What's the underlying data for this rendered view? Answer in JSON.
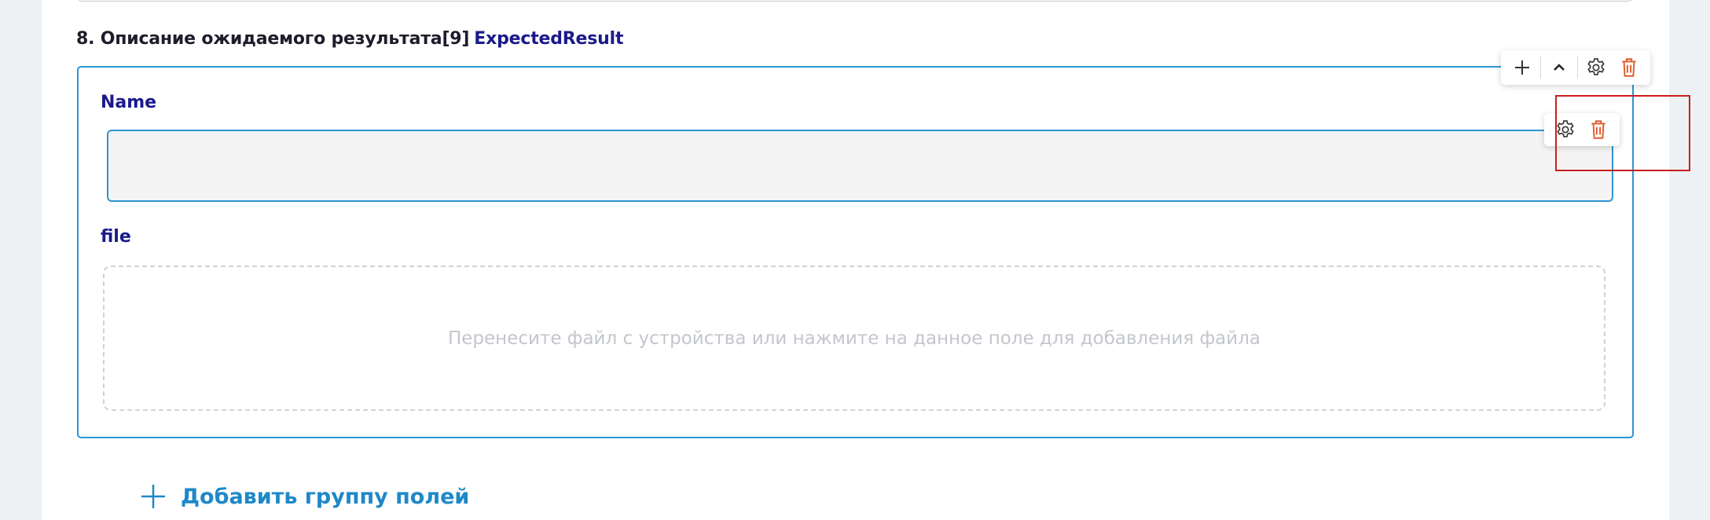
{
  "section": {
    "title": "8. Описание ожидаемого результата[9]",
    "code": "ExpectedResult"
  },
  "fields": {
    "name_label": "Name",
    "name_value": "",
    "file_label": "file",
    "dropzone_text": "Перенесите файл с устройства или нажмите на данное поле для добавления файла"
  },
  "group_toolbar": {
    "icons": [
      "plus-icon",
      "chevron-up-icon",
      "gear-icon",
      "trash-icon"
    ]
  },
  "field_toolbar": {
    "icons": [
      "gear-icon",
      "trash-icon"
    ]
  },
  "add_group": {
    "label": "Добавить группу полей"
  },
  "colors": {
    "accent": "#2f95d3",
    "label": "#1a1a8c",
    "danger": "#e05a2b",
    "highlight": "#c81e1e"
  }
}
